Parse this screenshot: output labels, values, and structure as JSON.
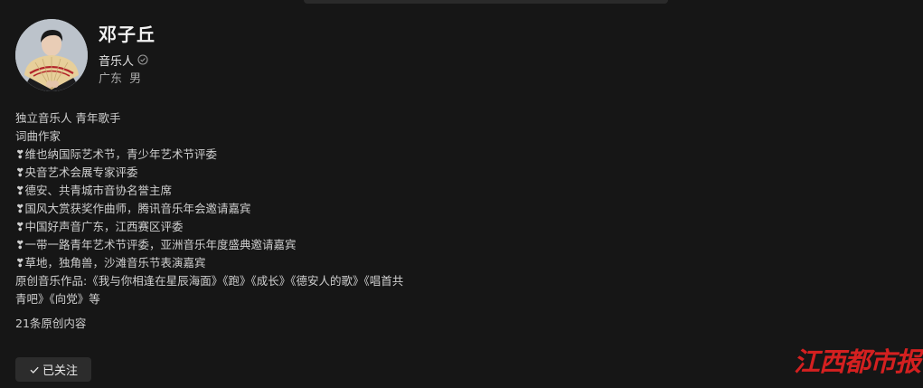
{
  "profile": {
    "name": "邓子丘",
    "role": "音乐人",
    "region": "广东",
    "gender": "男"
  },
  "bio": [
    "独立音乐人 青年歌手",
    "词曲作家",
    "❣维也纳国际艺术节，青少年艺术节评委",
    "❣央音艺术会展专家评委",
    "❣德安、共青城市音协名誉主席",
    "❣国风大赏获奖作曲师，腾讯音乐年会邀请嘉宾",
    "❣中国好声音广东，江西赛区评委",
    "❣一带一路青年艺术节评委，亚洲音乐年度盛典邀请嘉宾",
    "❣草地，独角兽，沙滩音乐节表演嘉宾",
    "原创音乐作品:《我与你相逢在星辰海面》《跑》《成长》《德安人的歌》《唱首共青吧》《向党》等"
  ],
  "original_count": "21条原创内容",
  "follow_button": {
    "label": "已关注",
    "icon": "check-icon"
  },
  "watermark": "江西都市报",
  "colors": {
    "background": "#161616",
    "watermark": "#d42020"
  }
}
